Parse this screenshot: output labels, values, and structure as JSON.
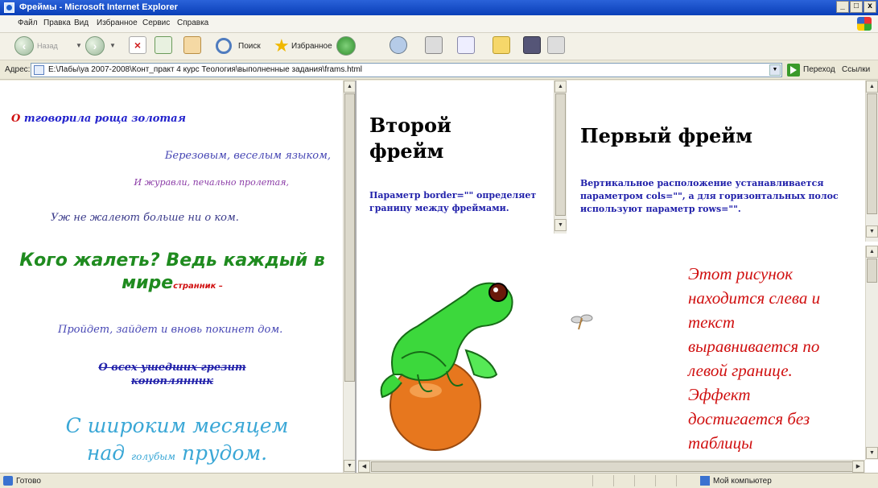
{
  "window": {
    "title": "Фреймы - Microsoft Internet Explorer",
    "min": "_",
    "max": "□",
    "close": "x"
  },
  "menu": [
    "Файл",
    "Правка",
    "Вид",
    "Избранное",
    "Сервис",
    "Справка"
  ],
  "toolbar": {
    "back": "Назад",
    "search": "Поиск",
    "favorites": "Избранное"
  },
  "address": {
    "label": "Адрес:",
    "value": "E:\\Лабы\\уа 2007-2008\\Конт_практ 4 курс Теология\\выполненные задания\\frams.html",
    "go": "Переход",
    "links": "Ссылки"
  },
  "left_frame": {
    "title_first": "О",
    "title_rest": " тговорила роща золотая",
    "lines": [
      "Березовым, веселым языком,",
      "И журавли, печально пролетая,",
      "Уж не жалеют больше ни о ком.",
      "Кого жалеть? Ведь каждый в мире",
      "странник –",
      "Пройдет, зайдет и вновь покинет дом.",
      "О всех ушедших грезит коноплянник",
      "С широким месяцем",
      "над",
      "голубым",
      "прудом."
    ]
  },
  "mid_frame": {
    "heading": "Второй фрейм",
    "paragraph": "Параметр border=\"\" определяет границу между фреймами."
  },
  "right_frame": {
    "heading": "Первый фрейм",
    "paragraph": "Вертикальное расположение устанавливается параметром cols=\"\", а для горизонтальных полос используют параметр rows=\"\"."
  },
  "bottom_frame": {
    "image": "frog-on-ball",
    "decoration": "dragonfly",
    "text": "Этот рисунок находится слева и текст выравнивается по левой границе. Эффект достигается без таблицы"
  },
  "status": {
    "left": "Готово",
    "zone": "Мой компьютер"
  }
}
